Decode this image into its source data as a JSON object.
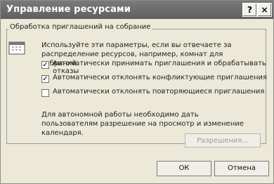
{
  "window": {
    "title": "Управление ресурсами",
    "help_glyph": "?",
    "close_glyph": "×"
  },
  "group": {
    "label": "Обработка приглашений на собрание",
    "description": "Используйте эти параметры, если вы отвечаете за распределение ресурсов, например, комнат для собраний.",
    "icon": "calendar-icon"
  },
  "options": [
    {
      "label": "Автоматически принимать приглашения и обрабатывать отказы",
      "checked": true
    },
    {
      "label": "Автоматически отклонять конфликтующие приглашения",
      "checked": true
    },
    {
      "label": "Автоматически отклонять повторяющиеся приглашения",
      "checked": false
    }
  ],
  "permissions": {
    "note": "Для автономной работы необходимо дать пользователям разрешение на просмотр и изменение календаря.",
    "button": "Разрешения..."
  },
  "buttons": {
    "ok": "ОК",
    "cancel": "Отмена"
  }
}
